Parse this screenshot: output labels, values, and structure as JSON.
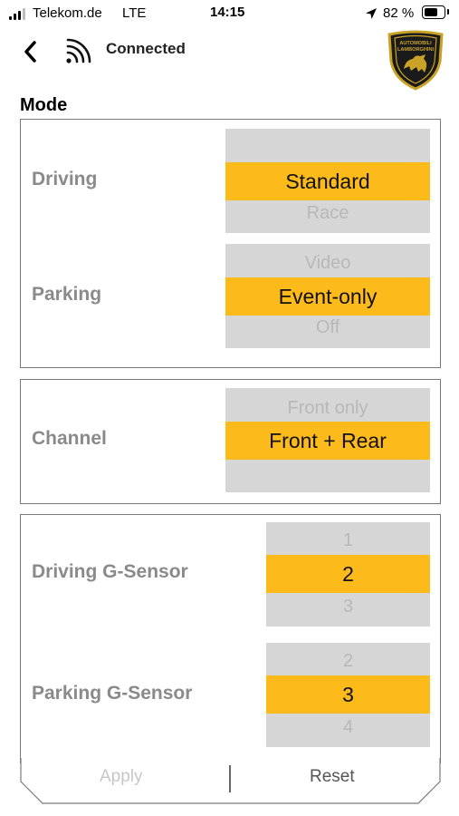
{
  "status_bar": {
    "carrier": "Telekom.de",
    "network": "LTE",
    "time": "14:15",
    "battery_percent": "82 %",
    "battery_level": 0.82,
    "icons": [
      "signal-icon",
      "location-arrow-icon",
      "battery-icon"
    ]
  },
  "header": {
    "connection_status": "Connected",
    "icons": [
      "back-chevron-icon",
      "wifi-signal-icon",
      "lamborghini-logo"
    ],
    "logo_text": "AUTOMOBILI LAMBORGHINI"
  },
  "mode": {
    "title": "Mode",
    "driving": {
      "label": "Driving",
      "prev": "",
      "selected": "Standard",
      "next": "Race"
    },
    "parking": {
      "label": "Parking",
      "prev": "Video",
      "selected": "Event-only",
      "next": "Off"
    }
  },
  "channel": {
    "label": "Channel",
    "prev": "Front only",
    "selected": "Front + Rear",
    "next": ""
  },
  "sensors": {
    "driving": {
      "label": "Driving G-Sensor",
      "prev": "1",
      "selected": "2",
      "next": "3"
    },
    "parking": {
      "label": "Parking G-Sensor",
      "prev": "2",
      "selected": "3",
      "next": "4"
    }
  },
  "actions": {
    "apply": "Apply",
    "reset": "Reset"
  },
  "colors": {
    "accent": "#fdbb1b",
    "picker_bg": "#d6d6d6",
    "label": "#8a8a8a"
  }
}
